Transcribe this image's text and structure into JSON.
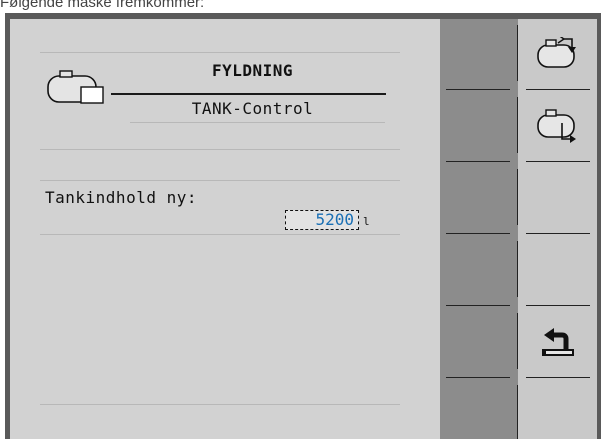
{
  "caption": "Følgende måske fremkommer:",
  "screen": {
    "title": "FYLDNING",
    "subtitle": "TANK-Control",
    "field_label": "Tankindhold ny:",
    "field_value": "5200",
    "unit": "l"
  },
  "softkeys": [
    {
      "icon": "tank-fill-in-icon"
    },
    {
      "icon": "tank-fill-out-icon"
    },
    {
      "icon": "empty"
    },
    {
      "icon": "empty"
    },
    {
      "icon": "return-arrow-icon"
    },
    {
      "icon": "empty"
    }
  ]
}
